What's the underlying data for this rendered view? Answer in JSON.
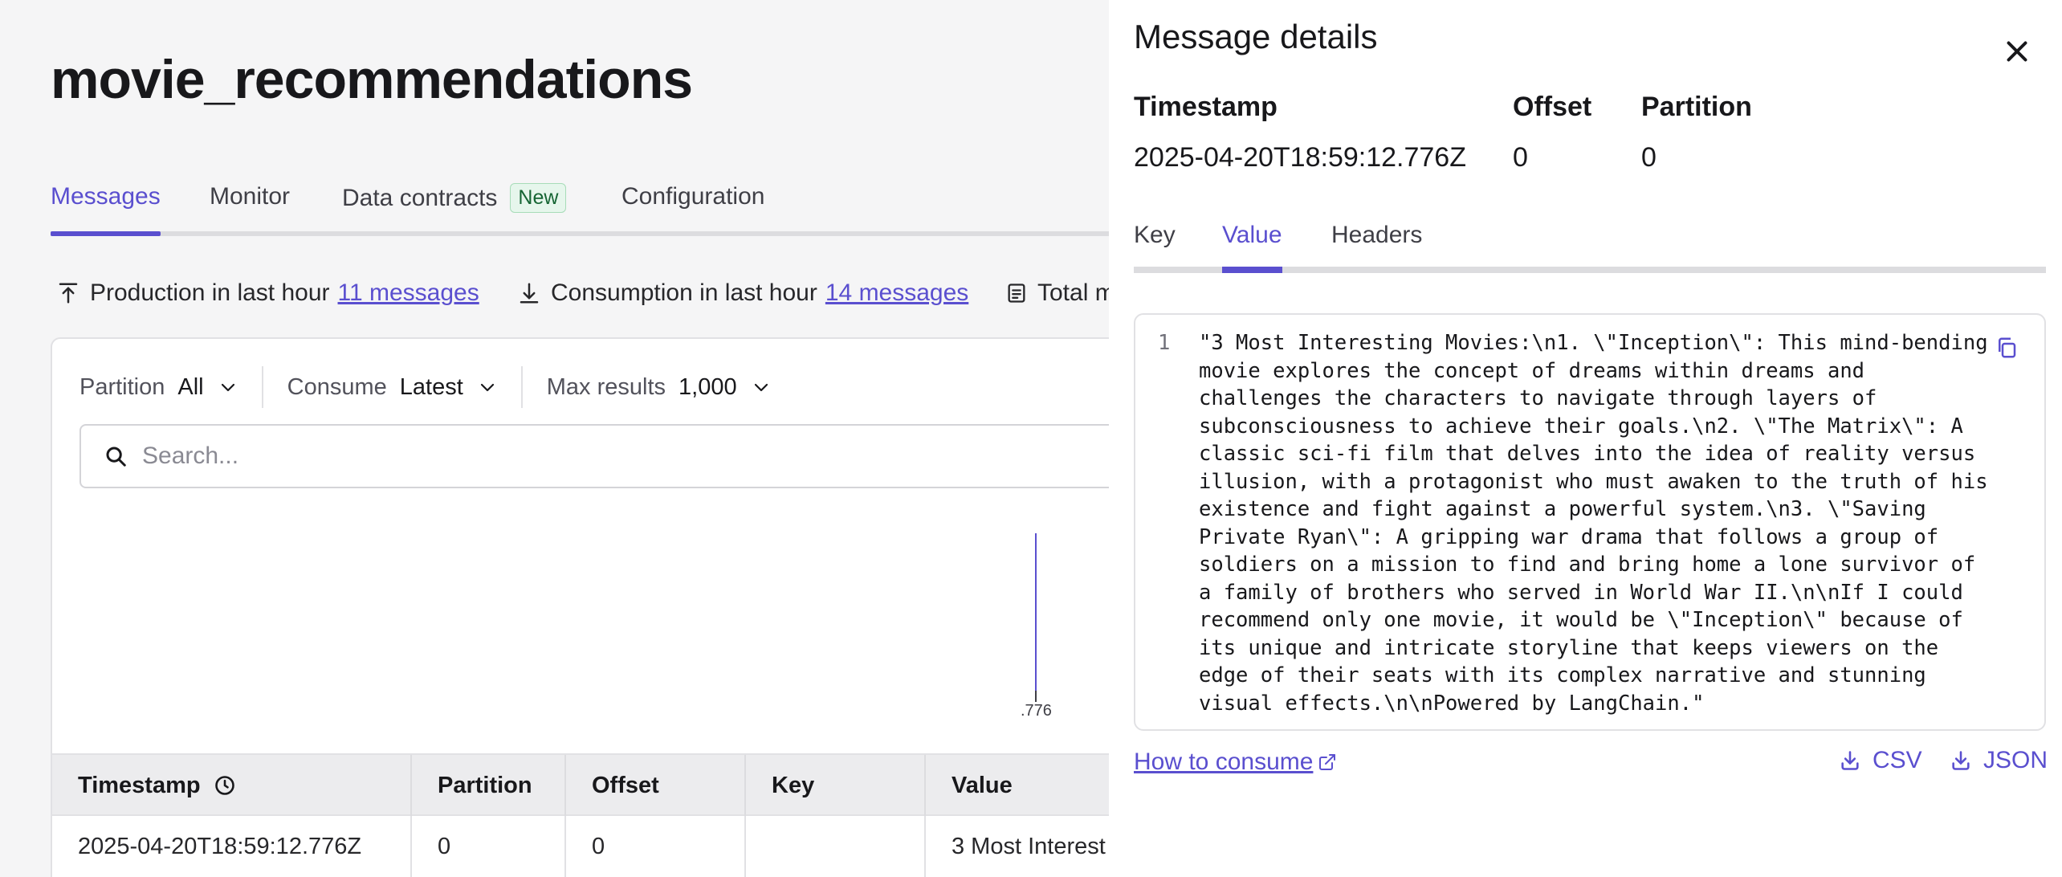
{
  "page": {
    "title": "movie_recommendations"
  },
  "tabs": [
    {
      "label": "Messages"
    },
    {
      "label": "Monitor"
    },
    {
      "label": "Data contracts",
      "badge": "New"
    },
    {
      "label": "Configuration"
    }
  ],
  "stats": {
    "production_label": "Production in last hour",
    "production_link": "11 messages",
    "consumption_label": "Consumption in last hour",
    "consumption_link": "14 messages",
    "total_label": "Total m"
  },
  "filters": {
    "partition_label": "Partition",
    "partition_value": "All",
    "consume_label": "Consume",
    "consume_value": "Latest",
    "max_results_label": "Max results",
    "max_results_value": "1,000"
  },
  "search": {
    "placeholder": "Search..."
  },
  "chart_data": {
    "type": "bar",
    "tick_labels": [
      ".776"
    ],
    "values": [
      1
    ]
  },
  "table": {
    "headers": [
      "Timestamp",
      "Partition",
      "Offset",
      "Key",
      "Value"
    ],
    "rows": [
      {
        "timestamp": "2025-04-20T18:59:12.776Z",
        "partition": "0",
        "offset": "0",
        "key": "",
        "value": "3 Most Interest"
      }
    ]
  },
  "drawer": {
    "title": "Message details",
    "timestamp_label": "Timestamp",
    "timestamp_value": "2025-04-20T18:59:12.776Z",
    "offset_label": "Offset",
    "offset_value": "0",
    "partition_label": "Partition",
    "partition_value": "0",
    "tabs": [
      {
        "label": "Key"
      },
      {
        "label": "Value"
      },
      {
        "label": "Headers"
      }
    ],
    "line_number": "1",
    "code": "\"3 Most Interesting Movies:\\n1. \\\"Inception\\\": This mind-bending movie explores the concept of dreams within dreams and challenges the characters to navigate through layers of subconsciousness to achieve their goals.\\n2. \\\"The Matrix\\\": A classic sci-fi film that delves into the idea of reality versus illusion, with a protagonist who must awaken to the truth of his existence and fight against a powerful system.\\n3. \\\"Saving Private Ryan\\\": A gripping war drama that follows a group of soldiers on a mission to find and bring home a lone survivor of a family of brothers who served in World War II.\\n\\nIf I could recommend only one movie, it would be \\\"Inception\\\" because of its unique and intricate storyline that keeps viewers on the edge of their seats with its complex narrative and stunning visual effects.\\n\\nPowered by LangChain.\"",
    "how_to_consume": "How to consume",
    "export_csv": "CSV",
    "export_json": "JSON"
  },
  "colors": {
    "accent": "#5a4fcf",
    "background": "#f5f5f6",
    "badge_bg": "#e6f6ec"
  }
}
